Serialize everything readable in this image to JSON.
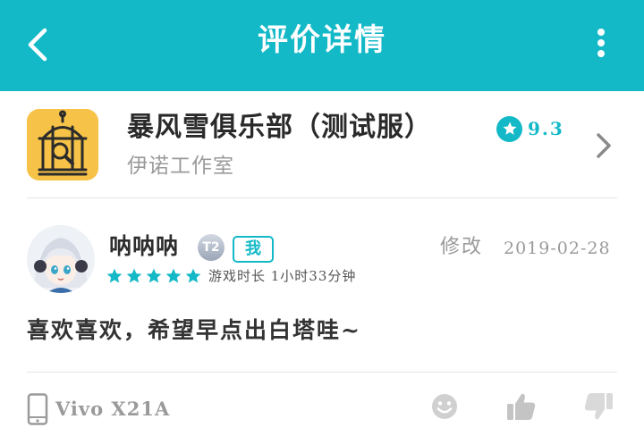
{
  "header": {
    "title": "评价详情"
  },
  "game": {
    "name": "暴风雪俱乐部（测试服）",
    "developer": "伊诺工作室",
    "rating": "9.3",
    "icon_bg": "#f6c247"
  },
  "review": {
    "username": "呐呐呐",
    "level": "T2",
    "me_tag": "我",
    "edit_label": "修改",
    "date": "2019-02-28",
    "star_rating": 5,
    "playtime": "游戏时长 1小时33分钟",
    "content": "喜欢喜欢，希望早点出白塔哇~"
  },
  "footer": {
    "device": "Vivo X21A"
  },
  "colors": {
    "accent": "#14b9c8",
    "star": "#14b9c8"
  }
}
